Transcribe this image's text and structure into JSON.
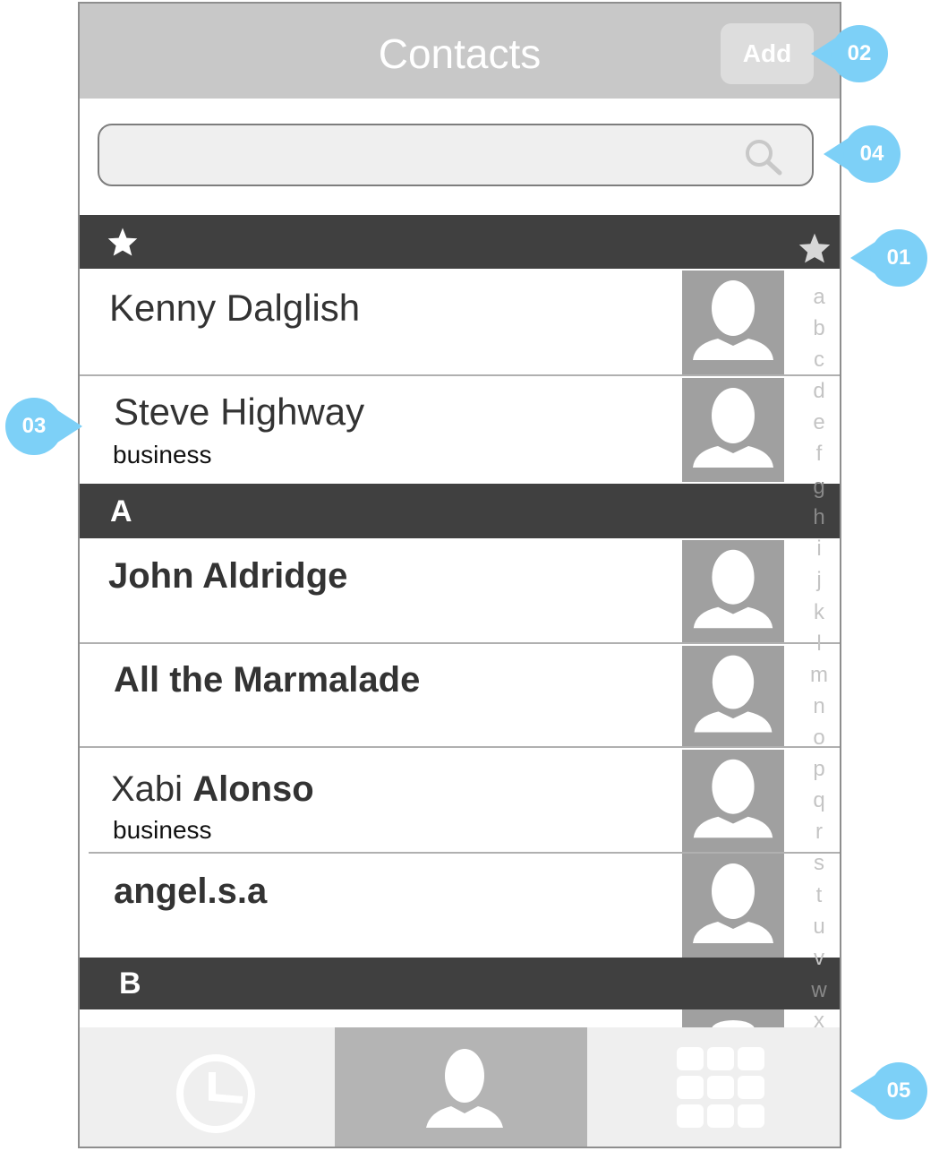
{
  "header": {
    "title": "Contacts",
    "add_label": "Add"
  },
  "search": {
    "placeholder": ""
  },
  "favorites": {
    "section_icon": "star-icon",
    "index_icon": "star-icon"
  },
  "sections": [
    {
      "label": "A"
    },
    {
      "label": "B"
    }
  ],
  "contacts": [
    {
      "name": "Kenny Dalglish",
      "subtitle": ""
    },
    {
      "name": "Steve Highway",
      "subtitle": "business"
    },
    {
      "name": "John Aldridge",
      "subtitle": ""
    },
    {
      "name": "All the Marmalade",
      "subtitle": ""
    },
    {
      "first": "Xabi",
      "last": "Alonso",
      "subtitle": "business"
    },
    {
      "name": "angel.s.a",
      "subtitle": ""
    }
  ],
  "index": [
    "a",
    "b",
    "c",
    "d",
    "e",
    "f",
    "g",
    "h",
    "i",
    "j",
    "k",
    "l",
    "m",
    "n",
    "o",
    "p",
    "q",
    "r",
    "s",
    "t",
    "u",
    "v",
    "w",
    "x"
  ],
  "tabs": [
    {
      "name": "recents",
      "icon": "clock-icon"
    },
    {
      "name": "contacts",
      "icon": "person-icon",
      "selected": true
    },
    {
      "name": "keypad",
      "icon": "keypad-icon"
    }
  ],
  "callouts": [
    "01",
    "02",
    "03",
    "04",
    "05"
  ],
  "colors": {
    "header": "#c8c8c8",
    "section": "#404040",
    "avatar": "#a0a0a0",
    "callout": "#7dd0f7",
    "tab_selected": "#b4b4b4"
  }
}
